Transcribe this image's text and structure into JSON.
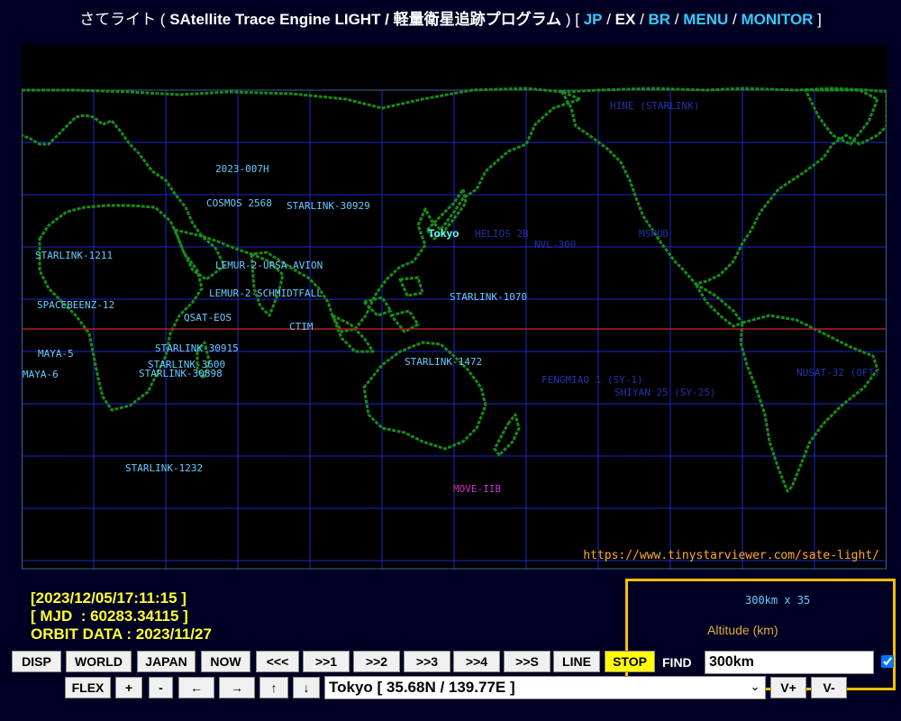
{
  "title": {
    "prefix": "さてライト ( ",
    "app_name": "SAtellite Trace Engine LIGHT / 軽量衛星追跡プログラム",
    "middle": " ) [ ",
    "links": [
      {
        "label": "JP",
        "accent": true
      },
      {
        "label": "EX",
        "accent": false
      },
      {
        "label": "BR",
        "accent": true
      },
      {
        "label": "MENU",
        "accent": true
      },
      {
        "label": "MONITOR",
        "accent": true
      }
    ],
    "separator": " / ",
    "suffix": " ]"
  },
  "map": {
    "site_url": "https://www.tinystarviewer.com/sate-light/",
    "observer_label": "Tokyo",
    "colors": {
      "land": "#1a8a1a",
      "grid": "#1a2acc",
      "equator": "#aa2222",
      "background": "#000000"
    },
    "satellites": [
      {
        "name": "2023-007H",
        "color": "#66ccff"
      },
      {
        "name": "COSMOS 2568",
        "color": "#66ccff"
      },
      {
        "name": "STARLINK-30929",
        "color": "#66ccff"
      },
      {
        "name": "STARLINK-1211",
        "color": "#66ccff"
      },
      {
        "name": "LEMUR-2-URSA-AVION",
        "color": "#66ccff"
      },
      {
        "name": "LEMUR-2-SCHMIDTFALL",
        "color": "#66ccff"
      },
      {
        "name": "SPACEBEENZ-12",
        "color": "#66ccff"
      },
      {
        "name": "QSAT-EOS",
        "color": "#66ccff"
      },
      {
        "name": "CTIM",
        "color": "#66ccff"
      },
      {
        "name": "STARLINK-30915",
        "color": "#66ccff"
      },
      {
        "name": "MAYA-5",
        "color": "#66ccff"
      },
      {
        "name": "STARLINK-3600",
        "color": "#66ccff"
      },
      {
        "name": "STARLINK-30898",
        "color": "#66ccff"
      },
      {
        "name": "MAYA-6",
        "color": "#66ccff"
      },
      {
        "name": "STARLINK-1232",
        "color": "#66ccff"
      },
      {
        "name": "HELIOS 2B",
        "color": "#2233aa"
      },
      {
        "name": "NVL-300",
        "color": "#2233aa"
      },
      {
        "name": "STARLINK-1070",
        "color": "#66ccff"
      },
      {
        "name": "MSPUD",
        "color": "#2233aa"
      },
      {
        "name": "STARLINK-1472",
        "color": "#66ccff"
      },
      {
        "name": "FENGMIAO 1 (SY-1)",
        "color": "#2233aa"
      },
      {
        "name": "SHIYAN 25 (SY-25)",
        "color": "#2233aa"
      },
      {
        "name": "NUSAT-32 (OFT)",
        "color": "#2233aa"
      },
      {
        "name": "HINE (STARLINK)",
        "color": "#2233aa"
      },
      {
        "name": "MOVE-IIB",
        "color": "#cc33cc"
      }
    ]
  },
  "info": {
    "datetime": "[2023/12/05/17:11:15 ]",
    "mjd": "[ MJD  : 60283.34115 ]",
    "orbit": "ORBIT DATA : 2023/11/27"
  },
  "find": {
    "count_text": "300km x 35",
    "caption": "Altitude (km)",
    "label": "FIND",
    "value": "300km",
    "checked": true
  },
  "controls": {
    "row1": [
      "DISP",
      "WORLD",
      "JAPAN",
      "NOW",
      "<<<",
      ">>1",
      ">>2",
      ">>3",
      ">>4",
      ">>S",
      "LINE",
      "STOP"
    ],
    "row2": [
      "FLEX",
      "+",
      "-",
      "←",
      "→",
      "↑",
      "↓"
    ],
    "zoom": [
      "V+",
      "V-"
    ]
  },
  "location": {
    "selected": "Tokyo [ 35.68N / 139.77E ]"
  }
}
